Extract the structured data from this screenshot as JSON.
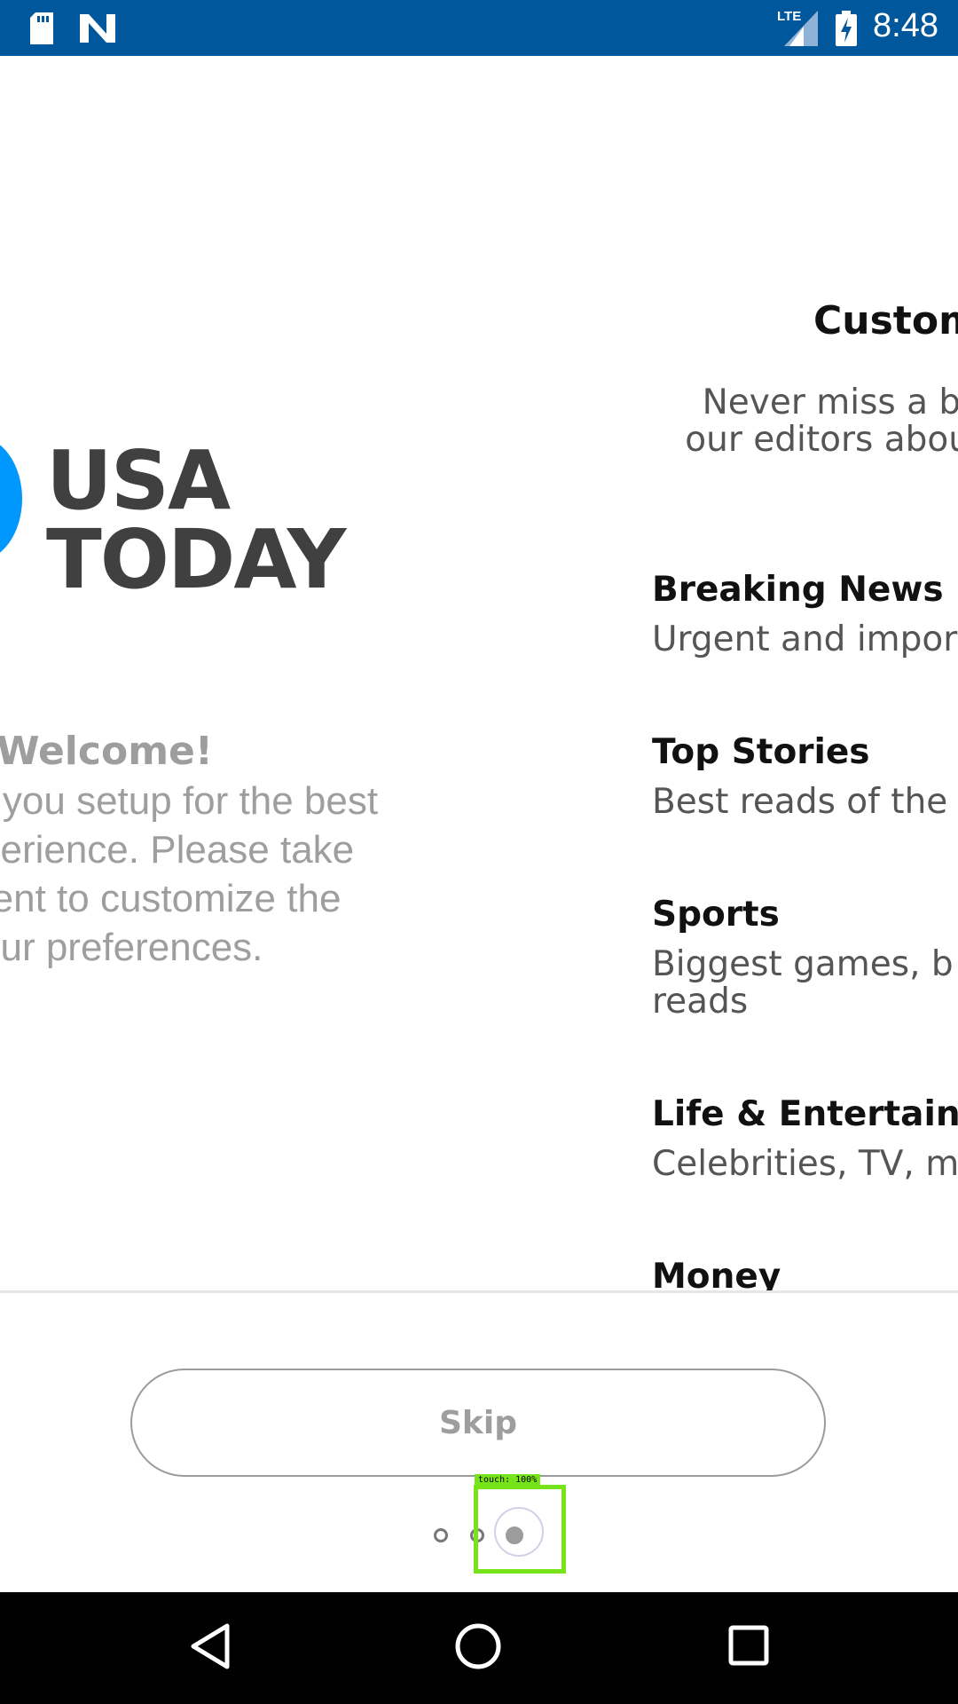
{
  "status_bar": {
    "time": "8:48",
    "network": "LTE",
    "icons": [
      "sd-card-icon",
      "n-notification-icon",
      "lte-signal-icon",
      "battery-charging-icon"
    ]
  },
  "welcome": {
    "logo_line1": "USA",
    "logo_line2": "TODAY",
    "title": "Welcome!",
    "body": "et you setup for the best\nxperience. Please take\nment to customize the\nyour preferences."
  },
  "customize": {
    "title": "Custom",
    "subtitle": "Never miss a bi\nour editors abou",
    "categories": [
      {
        "title": "Breaking News",
        "desc": "Urgent and impor"
      },
      {
        "title": "Top Stories",
        "desc": "Best reads of the"
      },
      {
        "title": "Sports",
        "desc": "Biggest games, b\nreads"
      },
      {
        "title": "Life & Entertainm",
        "desc": "Celebrities, TV, m"
      },
      {
        "title": "Money",
        "desc": ""
      }
    ]
  },
  "skip_label": "Skip",
  "page_indicator": {
    "count": 3,
    "active_index": 2
  },
  "touch_overlay": {
    "label": "touch: 100%"
  },
  "colors": {
    "status_bar": "#00579c",
    "logo_blue": "#0098fe",
    "touch_highlight": "#77e41a"
  },
  "nav_bar": {
    "icons": [
      "back-icon",
      "home-icon",
      "recents-icon"
    ]
  }
}
